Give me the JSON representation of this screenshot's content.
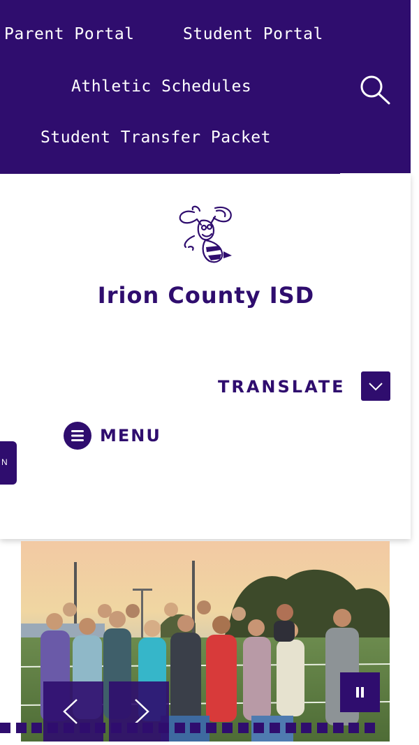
{
  "topnav": {
    "links": [
      "Parent Portal",
      "Student Portal",
      "Athletic Schedules",
      "Student Transfer Packet"
    ],
    "search_icon": "search-icon"
  },
  "header": {
    "logo_icon": "hornet-mascot-logo",
    "title": "Irion County ISD"
  },
  "translate": {
    "label": "TRANSLATE",
    "icon": "chevron-down-icon"
  },
  "menu": {
    "label": "MENU",
    "icon": "hamburger-icon"
  },
  "side_tab": {
    "label": "N"
  },
  "slideshow": {
    "image_alt": "Group of students standing on a football field at sunset",
    "pause_icon": "pause-icon",
    "prev_icon": "chevron-left-icon",
    "next_icon": "chevron-right-icon",
    "dot_count": 24
  },
  "colors": {
    "brand": "#2f0d6e",
    "text_on_brand": "#ffffff"
  }
}
